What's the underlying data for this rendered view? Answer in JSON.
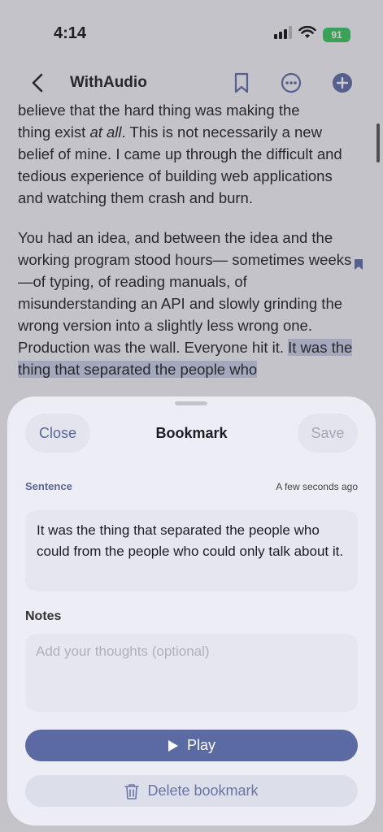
{
  "status_bar": {
    "time": "4:14",
    "battery": "91"
  },
  "nav": {
    "title": "WithAudio"
  },
  "article": {
    "p1_lines": [
      "believe that the hard thing was making the",
      "thing exist ",
      "at all",
      ". This is not necessarily a new belief of mine. I came up through the difficult and tedious experience of building web applications and watching them crash and burn."
    ],
    "p2_text": "You had an idea, and between the idea and the working program stood hours— sometimes weeks—of typing, of reading manuals, of misunderstanding an API and slowly grinding the wrong version into a slightly less wrong one. Production was the wall. Everyone hit it. ",
    "p2_highlight": "It was the thing that separated the people who"
  },
  "sheet": {
    "close_label": "Close",
    "title": "Bookmark",
    "save_label": "Save",
    "sentence_label": "Sentence",
    "timestamp": "A few seconds ago",
    "sentence_text": "It was the thing that separated the people who could from the people who could only talk about it.",
    "notes_label": "Notes",
    "notes_placeholder": "Add your thoughts (optional)",
    "notes_value": "",
    "play_label": "Play",
    "delete_label": "Delete bookmark"
  },
  "colors": {
    "accent": "#5c6aa3",
    "highlight": "#c9cfe6",
    "battery": "#35c759"
  },
  "icons": {
    "back": "chevron-left-icon",
    "bookmark": "bookmark-icon",
    "more": "ellipsis-circle-icon",
    "add": "plus-circle-icon",
    "play": "play-icon",
    "trash": "trash-icon"
  }
}
